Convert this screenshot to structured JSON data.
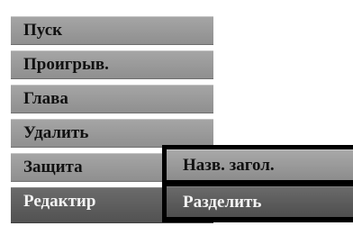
{
  "menu": {
    "items": [
      {
        "label": "Пуск"
      },
      {
        "label": "Проигрыв."
      },
      {
        "label": "Глава"
      },
      {
        "label": "Удалить"
      },
      {
        "label": "Защита"
      },
      {
        "label": "Редактир",
        "arrow": "›"
      }
    ]
  },
  "submenu": {
    "items": [
      {
        "label": "Назв. загол."
      },
      {
        "label": "Разделить"
      }
    ]
  },
  "colors": {
    "menu_item": "#9a9a9a",
    "active_item": "#5e5e5e",
    "submenu_frame": "#000000",
    "text_dark": "#111111",
    "text_light": "#f2f2f2"
  }
}
